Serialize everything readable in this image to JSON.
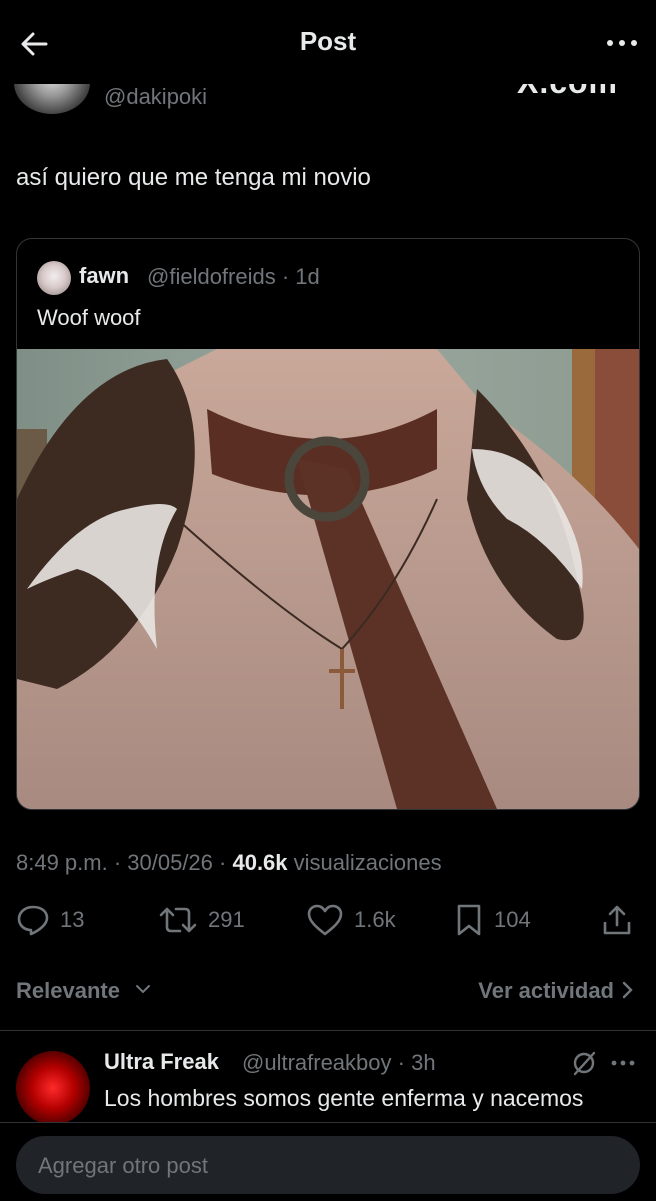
{
  "header": {
    "title": "Post",
    "back_icon": "arrow-left-icon",
    "more_icon": "more-horizontal-icon"
  },
  "post": {
    "author_handle": "@dakipoki",
    "watermark": "X.com",
    "text": "así quiero que me tenga mi novio",
    "timestamp": "8:49 p.m. · 30/05/26 · ",
    "views_count": "40.6k",
    "views_label": " visualizaciones"
  },
  "quoted_post": {
    "author_name": "fawn",
    "author_handle": "@fieldofreids",
    "age": "· 1d",
    "text": "Woof woof"
  },
  "actions": {
    "replies": "13",
    "reposts": "291",
    "likes": "1.6k",
    "bookmarks": "104"
  },
  "sort": {
    "label": "Relevante",
    "activity_link": "Ver actividad"
  },
  "reply": {
    "author_name": "Ultra Freak",
    "author_handle": "@ultrafreakboy",
    "age": "· 3h",
    "text": "Los hombres somos gente enferma y nacemos"
  },
  "composer": {
    "placeholder": "Agregar otro post"
  },
  "colors": {
    "background": "#000000",
    "text_primary": "#e7e9ea",
    "text_secondary": "#71767b",
    "border": "#2f3336",
    "composer_bg": "#202327"
  }
}
